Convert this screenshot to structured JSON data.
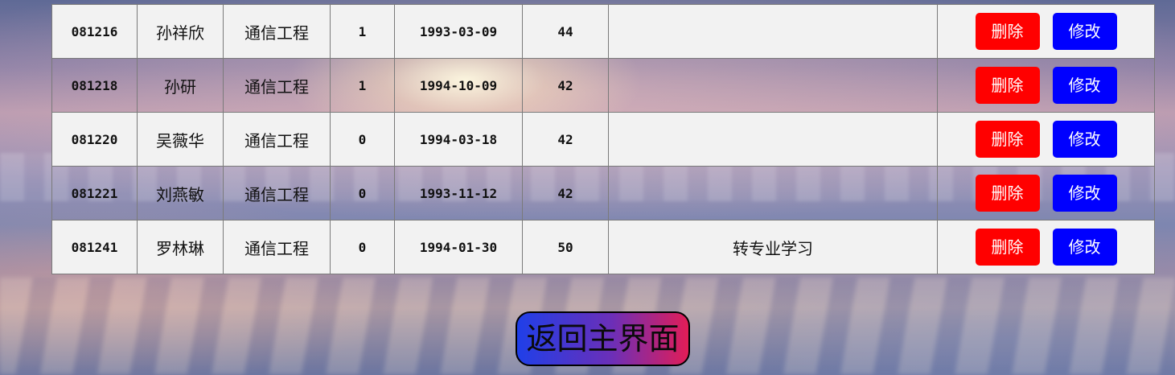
{
  "table": {
    "rows": [
      {
        "id": "081216",
        "name": "孙祥欣",
        "major": "通信工程",
        "sex": "1",
        "birthday": "1993-03-09",
        "credits": "44",
        "remark": "",
        "delete_label": "删除",
        "edit_label": "修改"
      },
      {
        "id": "081218",
        "name": "孙研",
        "major": "通信工程",
        "sex": "1",
        "birthday": "1994-10-09",
        "credits": "42",
        "remark": "",
        "delete_label": "删除",
        "edit_label": "修改"
      },
      {
        "id": "081220",
        "name": "吴薇华",
        "major": "通信工程",
        "sex": "0",
        "birthday": "1994-03-18",
        "credits": "42",
        "remark": "",
        "delete_label": "删除",
        "edit_label": "修改"
      },
      {
        "id": "081221",
        "name": "刘燕敏",
        "major": "通信工程",
        "sex": "0",
        "birthday": "1993-11-12",
        "credits": "42",
        "remark": "",
        "delete_label": "删除",
        "edit_label": "修改"
      },
      {
        "id": "081241",
        "name": "罗林琳",
        "major": "通信工程",
        "sex": "0",
        "birthday": "1994-01-30",
        "credits": "50",
        "remark": "转专业学习",
        "delete_label": "删除",
        "edit_label": "修改"
      }
    ]
  },
  "home_button": {
    "label": "返回主界面"
  },
  "colors": {
    "delete_button": "#ff0000",
    "edit_button": "#0000ff",
    "row_light": "#f2f2f2",
    "home_gradient_start": "#1f3fe8",
    "home_gradient_end": "#e21d57"
  }
}
